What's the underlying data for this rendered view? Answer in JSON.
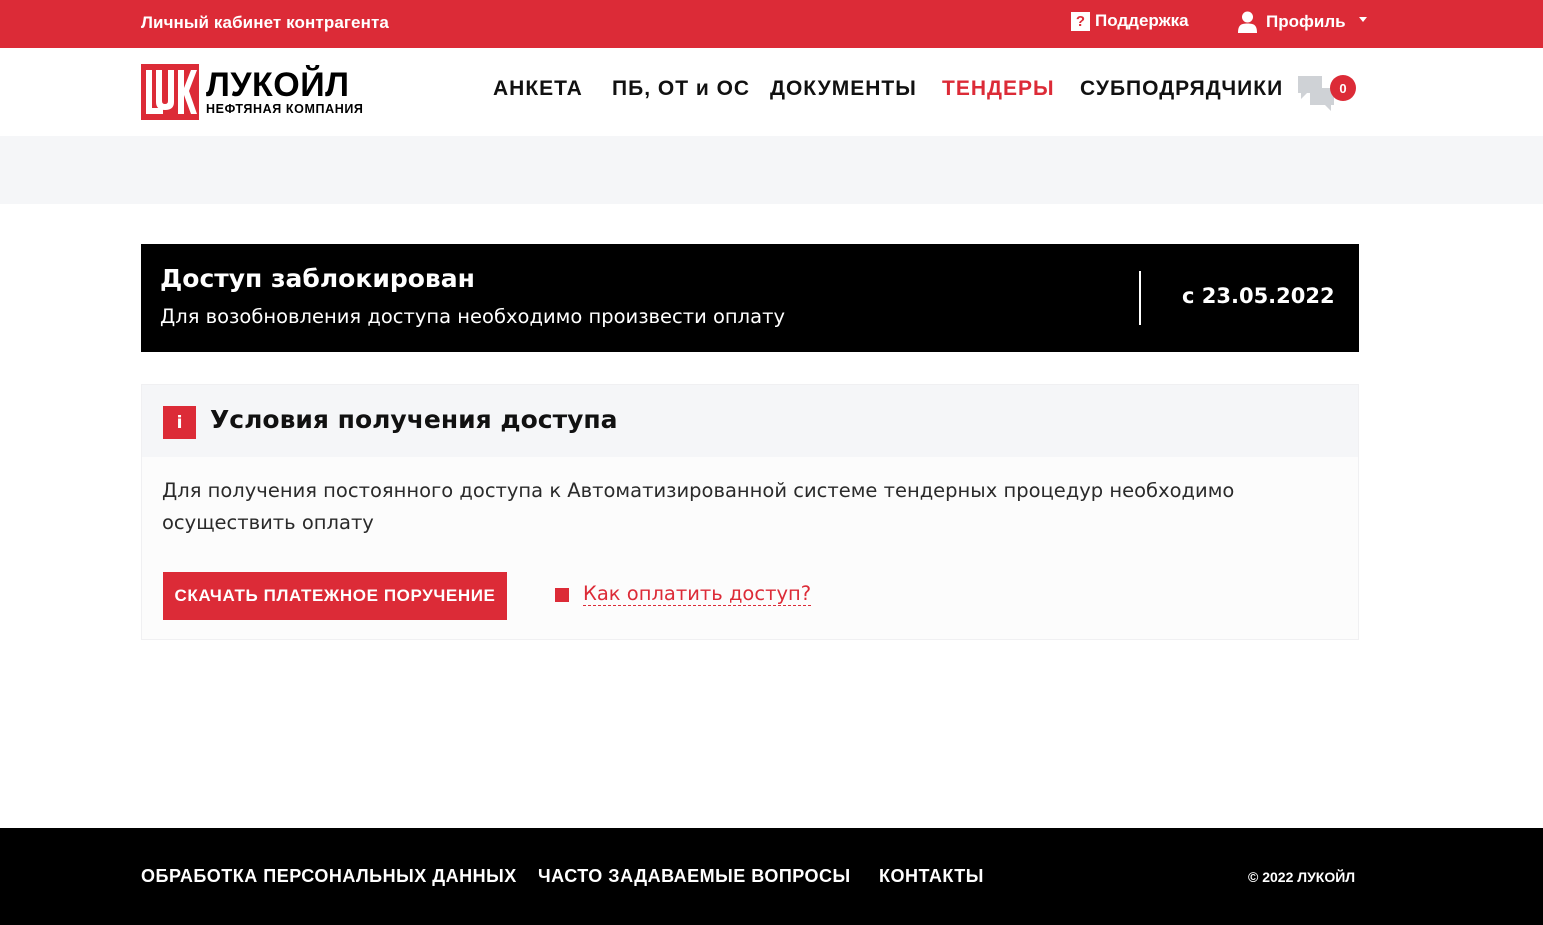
{
  "topbar": {
    "cabinet_label": "Личный кабинет контрагента",
    "support_label": "Поддержка",
    "profile_label": "Профиль"
  },
  "brand": {
    "name": "ЛУКОЙЛ",
    "subtitle": "НЕФТЯНАЯ КОМПАНИЯ",
    "color": "#dc2b37"
  },
  "nav": {
    "items": [
      {
        "label": "АНКЕТА",
        "active": false
      },
      {
        "label": "ПБ, ОТ и ОС",
        "active": false
      },
      {
        "label": "ДОКУМЕНТЫ",
        "active": false
      },
      {
        "label": "ТЕНДЕРЫ",
        "active": true
      },
      {
        "label": "СУБПОДРЯДЧИКИ",
        "active": false
      }
    ],
    "messages_count": "0"
  },
  "blocked": {
    "title": "Доступ заблокирован",
    "subtitle": "Для возобновления доступа необходимо произвести оплату",
    "date": "с 23.05.2022"
  },
  "conditions": {
    "icon_label": "i",
    "title": "Условия получения доступа",
    "text": "Для получения постоянного доступа к Автоматизированной системе тендерных процедур необходимо осуществить оплату",
    "download_button": "СКАЧАТЬ ПЛАТЕЖНОЕ ПОРУЧЕНИЕ",
    "how_to_pay_link": "Как оплатить доступ?"
  },
  "footer": {
    "links": [
      "ОБРАБОТКА ПЕРСОНАЛЬНЫХ ДАННЫХ",
      "ЧАСТО ЗАДАВАЕМЫЕ ВОПРОСЫ",
      "КОНТАКТЫ"
    ],
    "copyright": "© 2022 ЛУКОЙЛ"
  }
}
